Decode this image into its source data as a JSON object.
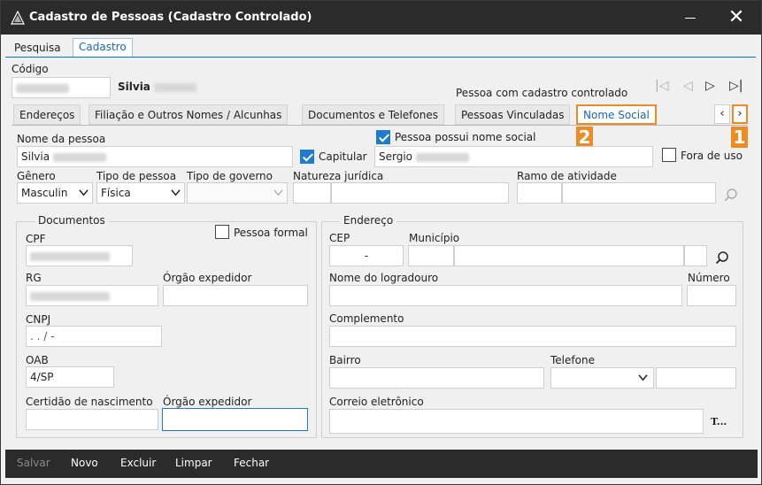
{
  "window": {
    "title": "Cadastro de Pessoas (Cadastro Controlado)",
    "close_label": "✕"
  },
  "top_tabs": [
    {
      "label": "Pesquisa",
      "active": false
    },
    {
      "label": "Cadastro",
      "active": true
    }
  ],
  "header": {
    "codigo_label": "Código",
    "person_name": "Silvia",
    "controlled_status": "Pessoa com cadastro controlado"
  },
  "record_nav": {
    "first": "|◁",
    "prev": "◁",
    "next": "▷",
    "last": "▷|"
  },
  "sub_tabs": [
    {
      "label": "Endereços",
      "active": false
    },
    {
      "label": "Filiação e Outros Nomes / Alcunhas",
      "active": false
    },
    {
      "label": "Documentos e Telefones",
      "active": false
    },
    {
      "label": "Pessoas Vinculadas",
      "active": false
    },
    {
      "label": "Nome Social",
      "active": true
    }
  ],
  "tab_scroll": {
    "left": "‹",
    "right": "›"
  },
  "annotations": {
    "badge_1": "1",
    "badge_2": "2"
  },
  "form": {
    "nome_label": "Nome da pessoa",
    "nome_value": "Silvia",
    "nome_social_check_label": "Pessoa possui nome social",
    "nome_social_checked": true,
    "capitular_label": "Capitular",
    "capitular_checked": true,
    "nome_social_value": "Sergio",
    "fora_de_uso_label": "Fora de uso",
    "fora_de_uso_checked": false,
    "genero_label": "Gênero",
    "genero_value": "Masculin",
    "tipo_pessoa_label": "Tipo de pessoa",
    "tipo_pessoa_value": "Física",
    "tipo_governo_label": "Tipo de governo",
    "tipo_governo_value": "",
    "natureza_label": "Natureza jurídica",
    "ramo_label": "Ramo de atividade"
  },
  "documentos": {
    "legend": "Documentos",
    "pessoa_formal_label": "Pessoa formal",
    "cpf_label": "CPF",
    "rg_label": "RG",
    "orgao_label": "Órgão expedidor",
    "cnpj_label": "CNPJ",
    "cnpj_mask": "  .   .   /    -",
    "oab_label": "OAB",
    "oab_value": "4/SP",
    "certidao_label": "Certidão de nascimento",
    "orgao2_label": "Órgão expedidor"
  },
  "endereco": {
    "legend": "Endereço",
    "cep_label": "CEP",
    "cep_mask": "-",
    "municipio_label": "Município",
    "logradouro_label": "Nome do logradouro",
    "numero_label": "Número",
    "complemento_label": "Complemento",
    "bairro_label": "Bairro",
    "telefone_label": "Telefone",
    "email_label": "Correio eletrônico",
    "email_btn": "T..."
  },
  "bottom_bar": {
    "salvar": "Salvar",
    "novo": "Novo",
    "excluir": "Excluir",
    "limpar": "Limpar",
    "fechar": "Fechar"
  },
  "colors": {
    "accent": "#1f7ad1",
    "highlight": "#ef8b23",
    "titlebar": "#2b2b2b"
  }
}
